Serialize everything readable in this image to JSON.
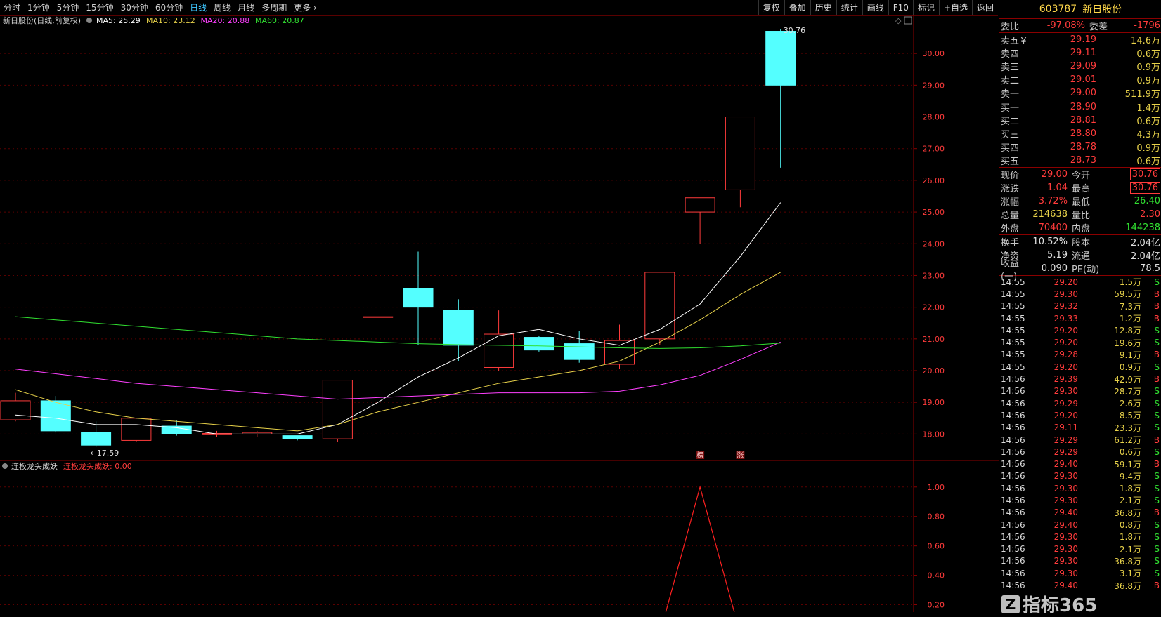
{
  "toolbar": {
    "periods": [
      "分时",
      "1分钟",
      "5分钟",
      "15分钟",
      "30分钟",
      "60分钟",
      "日线",
      "周线",
      "月线",
      "多周期",
      "更多"
    ],
    "active_period": "日线",
    "right_buttons": [
      "复权",
      "叠加",
      "历史",
      "统计",
      "画线",
      "F10",
      "标记",
      "+自选",
      "返回"
    ]
  },
  "main_chart": {
    "title": "新日股份(日线,前复权)",
    "ma_labels": [
      {
        "text": "MA5: 25.29",
        "color": "#ffffff"
      },
      {
        "text": "MA10: 23.12",
        "color": "#e8d24a"
      },
      {
        "text": "MA20: 20.88",
        "color": "#ff40ff"
      },
      {
        "text": "MA60: 20.87",
        "color": "#31e031"
      }
    ],
    "max_label": "30.76",
    "min_label": "17.59",
    "markers": [
      "榜",
      "涨"
    ]
  },
  "indicator_chart": {
    "title": "连板龙头成妖",
    "value_label": "连板龙头成妖: 0.00"
  },
  "chart_data": [
    {
      "type": "candlestick",
      "title": "新日股份(日线,前复权)",
      "ylim": [
        17.3,
        30.8
      ],
      "yticks": [
        "18.00",
        "19.00",
        "20.00",
        "21.00",
        "22.00",
        "23.00",
        "24.00",
        "25.00",
        "26.00",
        "27.00",
        "28.00",
        "29.00",
        "30.00"
      ],
      "candles": [
        {
          "o": 18.45,
          "h": 19.3,
          "l": 18.4,
          "c": 19.05
        },
        {
          "o": 19.05,
          "h": 19.2,
          "l": 18.05,
          "c": 18.1
        },
        {
          "o": 18.05,
          "h": 18.4,
          "l": 17.59,
          "c": 17.65
        },
        {
          "o": 17.8,
          "h": 18.5,
          "l": 17.75,
          "c": 18.5
        },
        {
          "o": 18.25,
          "h": 18.45,
          "l": 17.95,
          "c": 18.0
        },
        {
          "o": 17.98,
          "h": 18.1,
          "l": 17.9,
          "c": 18.02
        },
        {
          "o": 18.0,
          "h": 18.1,
          "l": 17.9,
          "c": 18.05
        },
        {
          "o": 17.95,
          "h": 17.95,
          "l": 17.8,
          "c": 17.85
        },
        {
          "o": 17.85,
          "h": 19.7,
          "l": 17.75,
          "c": 19.7
        },
        {
          "o": 21.7,
          "h": 21.7,
          "l": 21.7,
          "c": 21.7
        },
        {
          "o": 22.6,
          "h": 23.75,
          "l": 20.8,
          "c": 22.0
        },
        {
          "o": 21.9,
          "h": 22.25,
          "l": 20.3,
          "c": 20.8
        },
        {
          "o": 20.1,
          "h": 21.9,
          "l": 20.0,
          "c": 21.15
        },
        {
          "o": 21.05,
          "h": 21.1,
          "l": 20.6,
          "c": 20.65
        },
        {
          "o": 20.85,
          "h": 21.25,
          "l": 20.25,
          "c": 20.35
        },
        {
          "o": 20.2,
          "h": 21.45,
          "l": 20.05,
          "c": 20.95
        },
        {
          "o": 21.0,
          "h": 23.1,
          "l": 20.8,
          "c": 23.1
        },
        {
          "o": 25.0,
          "h": 25.45,
          "l": 24.0,
          "c": 25.45
        },
        {
          "o": 25.7,
          "h": 28.0,
          "l": 25.15,
          "c": 28.0
        },
        {
          "o": 30.7,
          "h": 30.76,
          "l": 26.4,
          "c": 29.0
        }
      ],
      "series": [
        {
          "name": "MA5",
          "color": "#ffffff",
          "values": [
            18.6,
            18.5,
            18.3,
            18.3,
            18.2,
            18.0,
            18.0,
            18.0,
            18.3,
            19.0,
            19.8,
            20.4,
            21.1,
            21.3,
            21.0,
            20.8,
            21.3,
            22.1,
            23.6,
            25.3
          ]
        },
        {
          "name": "MA10",
          "color": "#e8d24a",
          "values": [
            19.4,
            19.0,
            18.7,
            18.5,
            18.4,
            18.3,
            18.2,
            18.1,
            18.3,
            18.7,
            19.0,
            19.3,
            19.6,
            19.8,
            20.0,
            20.3,
            20.9,
            21.6,
            22.4,
            23.1
          ]
        },
        {
          "name": "MA20",
          "color": "#ff40ff",
          "values": [
            20.05,
            19.9,
            19.75,
            19.6,
            19.5,
            19.4,
            19.3,
            19.2,
            19.1,
            19.15,
            19.2,
            19.25,
            19.3,
            19.3,
            19.3,
            19.35,
            19.55,
            19.85,
            20.35,
            20.9
          ]
        },
        {
          "name": "MA60",
          "color": "#31e031",
          "values": [
            21.7,
            21.6,
            21.5,
            21.4,
            21.3,
            21.2,
            21.1,
            21.0,
            20.95,
            20.9,
            20.85,
            20.82,
            20.8,
            20.78,
            20.75,
            20.72,
            20.7,
            20.72,
            20.78,
            20.87
          ]
        }
      ]
    },
    {
      "type": "line",
      "title": "连板龙头成妖",
      "ylim": [
        0.15,
        1.08
      ],
      "yticks": [
        "1.00",
        "0.80",
        "0.60",
        "0.40",
        "0.20"
      ],
      "series": [
        {
          "name": "连板龙头成妖",
          "color": "#ff2020",
          "values": [
            0,
            0,
            0,
            0,
            0,
            0,
            0,
            0,
            0,
            0,
            0,
            0,
            0,
            0,
            0,
            0,
            0,
            1,
            0,
            0
          ]
        }
      ]
    }
  ],
  "quote_panel": {
    "header": {
      "code": "603787",
      "name": "新日股份"
    },
    "weibi": {
      "label": "委比",
      "value": "-97.08%",
      "label2": "委差",
      "value2": "-1796"
    },
    "asks": [
      {
        "label": "卖五￥",
        "price": "29.19",
        "vol": "14.6万"
      },
      {
        "label": "卖四",
        "price": "29.11",
        "vol": "0.6万"
      },
      {
        "label": "卖三",
        "price": "29.09",
        "vol": "0.9万"
      },
      {
        "label": "卖二",
        "price": "29.01",
        "vol": "0.9万"
      },
      {
        "label": "卖一",
        "price": "29.00",
        "vol": "511.9万"
      }
    ],
    "bids": [
      {
        "label": "买一",
        "price": "28.90",
        "vol": "1.4万"
      },
      {
        "label": "买二",
        "price": "28.81",
        "vol": "0.6万"
      },
      {
        "label": "买三",
        "price": "28.80",
        "vol": "4.3万"
      },
      {
        "label": "买四",
        "price": "28.78",
        "vol": "0.9万"
      },
      {
        "label": "买五",
        "price": "28.73",
        "vol": "0.6万"
      }
    ],
    "stats": [
      {
        "l1": "现价",
        "v1": "29.00",
        "c1": "red",
        "l2": "今开",
        "v2": "30.76",
        "c2": "red",
        "box": true
      },
      {
        "l1": "涨跌",
        "v1": "1.04",
        "c1": "red",
        "l2": "最高",
        "v2": "30.76",
        "c2": "red",
        "box": true
      },
      {
        "l1": "涨幅",
        "v1": "3.72%",
        "c1": "red",
        "l2": "最低",
        "v2": "26.40",
        "c2": "green",
        "box": false
      },
      {
        "l1": "总量",
        "v1": "214638",
        "c1": "yellow",
        "l2": "量比",
        "v2": "2.30",
        "c2": "red",
        "box": false
      },
      {
        "l1": "外盘",
        "v1": "70400",
        "c1": "red",
        "l2": "内盘",
        "v2": "144238",
        "c2": "green",
        "box": false
      }
    ],
    "stats2": [
      {
        "l1": "换手",
        "v1": "10.52%",
        "l2": "股本",
        "v2": "2.04亿"
      },
      {
        "l1": "净资",
        "v1": "5.19",
        "l2": "流通",
        "v2": "2.04亿"
      },
      {
        "l1": "收益(一)",
        "v1": "0.090",
        "l2": "PE(动)",
        "v2": "78.5"
      }
    ],
    "ticks": [
      {
        "t": "14:55",
        "p": "29.20",
        "v": "1.5万",
        "f": "S"
      },
      {
        "t": "14:55",
        "p": "29.30",
        "v": "59.5万",
        "f": "B"
      },
      {
        "t": "14:55",
        "p": "29.32",
        "v": "7.3万",
        "f": "B"
      },
      {
        "t": "14:55",
        "p": "29.33",
        "v": "1.2万",
        "f": "B"
      },
      {
        "t": "14:55",
        "p": "29.20",
        "v": "12.8万",
        "f": "S"
      },
      {
        "t": "14:55",
        "p": "29.20",
        "v": "19.6万",
        "f": "S"
      },
      {
        "t": "14:55",
        "p": "29.28",
        "v": "9.1万",
        "f": "B"
      },
      {
        "t": "14:55",
        "p": "29.20",
        "v": "0.9万",
        "f": "S"
      },
      {
        "t": "14:56",
        "p": "29.39",
        "v": "42.9万",
        "f": "B"
      },
      {
        "t": "14:56",
        "p": "29.30",
        "v": "28.7万",
        "f": "S"
      },
      {
        "t": "14:56",
        "p": "29.29",
        "v": "2.6万",
        "f": "S"
      },
      {
        "t": "14:56",
        "p": "29.20",
        "v": "8.5万",
        "f": "S"
      },
      {
        "t": "14:56",
        "p": "29.11",
        "v": "23.3万",
        "f": "S"
      },
      {
        "t": "14:56",
        "p": "29.29",
        "v": "61.2万",
        "f": "B"
      },
      {
        "t": "14:56",
        "p": "29.29",
        "v": "0.6万",
        "f": "S"
      },
      {
        "t": "14:56",
        "p": "29.40",
        "v": "59.1万",
        "f": "B"
      },
      {
        "t": "14:56",
        "p": "29.30",
        "v": "9.4万",
        "f": "S"
      },
      {
        "t": "14:56",
        "p": "29.30",
        "v": "1.8万",
        "f": "S"
      },
      {
        "t": "14:56",
        "p": "29.30",
        "v": "2.1万",
        "f": "S"
      },
      {
        "t": "14:56",
        "p": "29.40",
        "v": "36.8万",
        "f": "B"
      },
      {
        "t": "14:56",
        "p": "29.40",
        "v": "0.8万",
        "f": "S"
      },
      {
        "t": "14:56",
        "p": "29.30",
        "v": "1.8万",
        "f": "S"
      },
      {
        "t": "14:56",
        "p": "29.30",
        "v": "2.1万",
        "f": "S"
      },
      {
        "t": "14:56",
        "p": "29.30",
        "v": "36.8万",
        "f": "S"
      },
      {
        "t": "14:56",
        "p": "29.30",
        "v": "3.1万",
        "f": "S"
      },
      {
        "t": "14:56",
        "p": "29.40",
        "v": "36.8万",
        "f": "B"
      }
    ]
  },
  "watermark": {
    "icon": "Z",
    "text": "指标365"
  },
  "colors": {
    "up": "#ff3b3b",
    "down": "#54ffff",
    "grid": "#5a0000",
    "axis": "#8b0000"
  }
}
